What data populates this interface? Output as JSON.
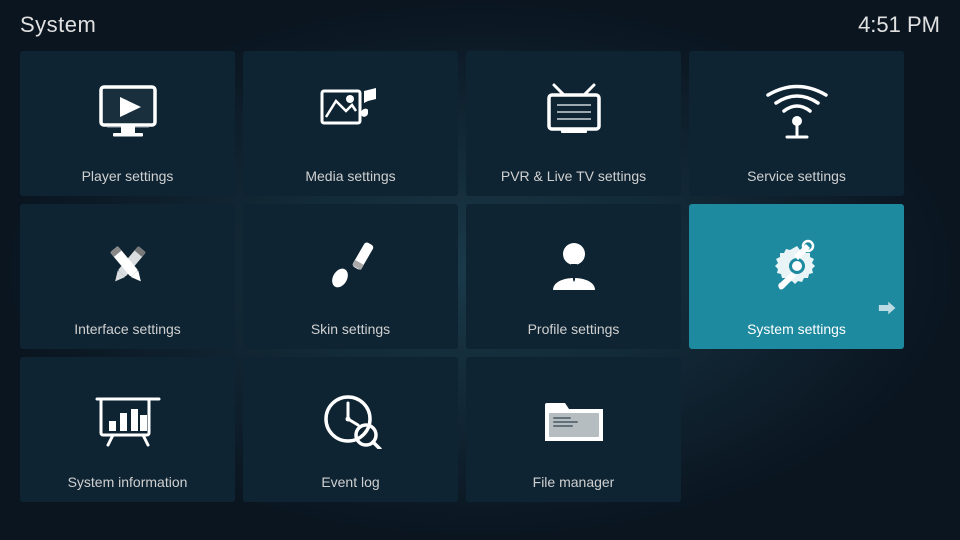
{
  "header": {
    "title": "System",
    "clock": "4:51 PM"
  },
  "tiles": [
    {
      "id": "player-settings",
      "label": "Player settings",
      "icon": "player",
      "active": false,
      "row": 1,
      "col": 1
    },
    {
      "id": "media-settings",
      "label": "Media settings",
      "icon": "media",
      "active": false,
      "row": 1,
      "col": 2
    },
    {
      "id": "pvr-livetv-settings",
      "label": "PVR & Live TV settings",
      "icon": "pvr",
      "active": false,
      "row": 1,
      "col": 3
    },
    {
      "id": "service-settings",
      "label": "Service settings",
      "icon": "service",
      "active": false,
      "row": 1,
      "col": 4
    },
    {
      "id": "interface-settings",
      "label": "Interface settings",
      "icon": "interface",
      "active": false,
      "row": 2,
      "col": 1
    },
    {
      "id": "skin-settings",
      "label": "Skin settings",
      "icon": "skin",
      "active": false,
      "row": 2,
      "col": 2
    },
    {
      "id": "profile-settings",
      "label": "Profile settings",
      "icon": "profile",
      "active": false,
      "row": 2,
      "col": 3
    },
    {
      "id": "system-settings",
      "label": "System settings",
      "icon": "system",
      "active": true,
      "row": 2,
      "col": 4
    },
    {
      "id": "system-information",
      "label": "System information",
      "icon": "sysinfo",
      "active": false,
      "row": 3,
      "col": 1
    },
    {
      "id": "event-log",
      "label": "Event log",
      "icon": "eventlog",
      "active": false,
      "row": 3,
      "col": 2
    },
    {
      "id": "file-manager",
      "label": "File manager",
      "icon": "filemanager",
      "active": false,
      "row": 3,
      "col": 3
    }
  ]
}
